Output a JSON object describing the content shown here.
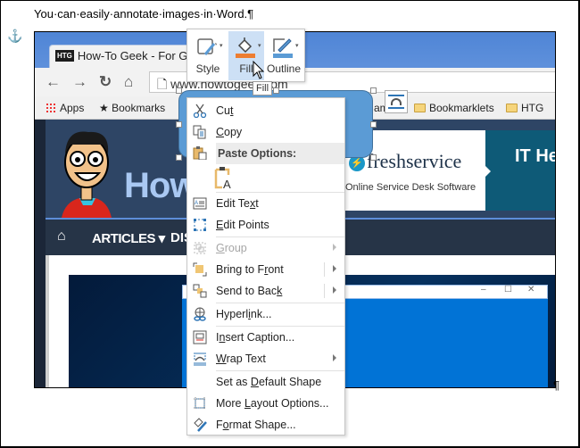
{
  "document": {
    "line_text": "You·can·easily·annotate·images·in·Word.¶",
    "end_pilcrow": "¶",
    "anchor_icon": "anchor-icon"
  },
  "screenshot_image": {
    "browser": {
      "tab_badge": "HTG",
      "tab_title": "How-To Geek - For Gee",
      "url": "www.howtogeek.com",
      "nav_icons": [
        "back-icon",
        "forward-icon",
        "reload-icon",
        "home-icon"
      ],
      "bookmarks": [
        {
          "label": "Apps",
          "icon": "apps-grid-icon"
        },
        {
          "label": "Bookmarks",
          "icon": "star-icon"
        },
        {
          "label": "Bookmarklets",
          "icon": "folder-icon"
        },
        {
          "label": "HTG",
          "icon": "folder-icon"
        }
      ],
      "bookmark_partial": "am"
    },
    "site": {
      "title": "How",
      "nav_articles": "ARTICLES ▾",
      "nav_partial": "DIS",
      "ad_brand": "freshservice",
      "ad_tagline": "Online Service Desk Software",
      "ad_teal_text": "IT He"
    },
    "window_controls": [
      "–",
      "☐",
      "✕"
    ]
  },
  "mini_toolbar": {
    "buttons": [
      {
        "label": "Style",
        "icon": "shape-style-icon",
        "active": false
      },
      {
        "label": "Fill",
        "icon": "paint-bucket-icon",
        "active": true,
        "color": "#ed7d31"
      },
      {
        "label": "Outline",
        "icon": "pen-outline-icon",
        "active": false,
        "color": "#5b9bd5"
      }
    ],
    "tooltip": "Fill"
  },
  "context_menu": {
    "items": [
      {
        "label": "Cut",
        "underline": "t",
        "icon": "scissors-icon"
      },
      {
        "label": "Copy",
        "underline": "C",
        "icon": "copy-icon"
      },
      {
        "label": "Paste Options:",
        "type": "header",
        "icon": "paste-icon"
      },
      {
        "label": "Keep Text Only",
        "type": "paste-option",
        "icon": "paste-keep-text-icon"
      },
      {
        "label": "Edit Text",
        "underline": "x",
        "icon": "edit-text-icon"
      },
      {
        "label": "Edit Points",
        "underline": "E",
        "icon": "edit-points-icon"
      },
      {
        "label": "Group",
        "underline": "G",
        "icon": "group-icon",
        "disabled": true,
        "submenu": true
      },
      {
        "label": "Bring to Front",
        "underline": "r",
        "icon": "bring-to-front-icon",
        "submenu": true
      },
      {
        "label": "Send to Back",
        "underline": "k",
        "icon": "send-to-back-icon",
        "submenu": true
      },
      {
        "label": "Hyperlink...",
        "underline": "i",
        "icon": "hyperlink-icon"
      },
      {
        "label": "Insert Caption...",
        "underline": "n",
        "icon": "insert-caption-icon"
      },
      {
        "label": "Wrap Text",
        "underline": "W",
        "icon": "wrap-text-icon",
        "submenu": true
      },
      {
        "label": "Set as Default Shape",
        "underline": "D",
        "icon": null
      },
      {
        "label": "More Layout Options...",
        "underline": "L",
        "icon": "layout-options-icon"
      },
      {
        "label": "Format Shape...",
        "underline": "o",
        "icon": "format-shape-icon"
      }
    ]
  },
  "colors": {
    "shape_fill": "#5b9bd5",
    "fill_swatch": "#ed7d31",
    "outline_swatch": "#5b9bd5",
    "active_button": "#cde0f5"
  }
}
